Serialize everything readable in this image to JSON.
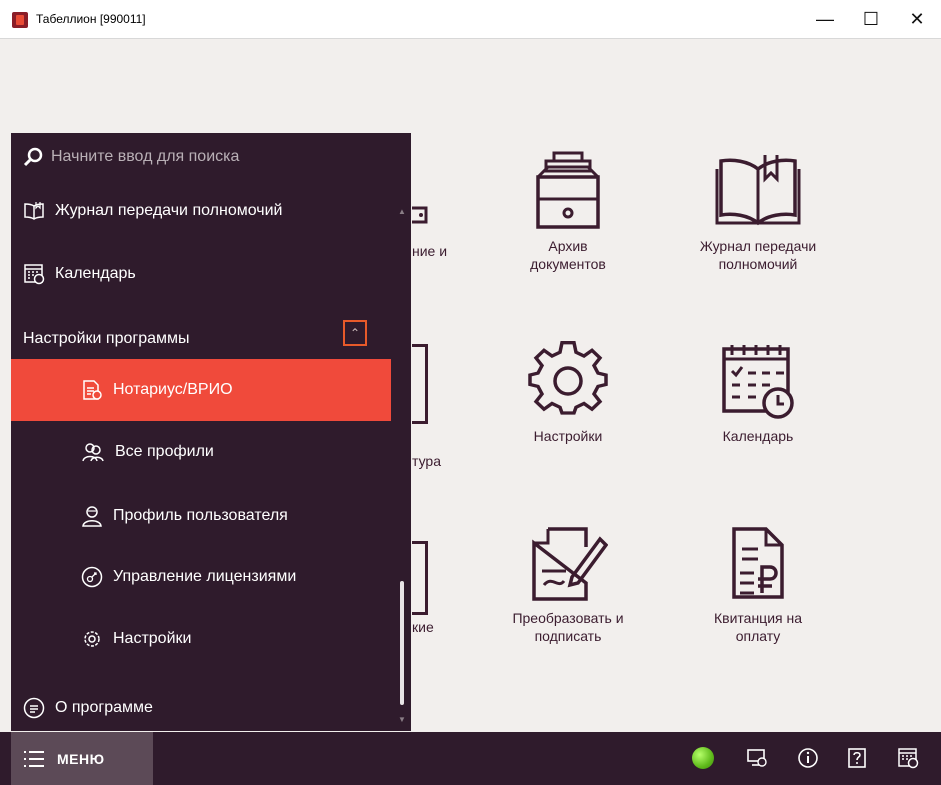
{
  "window": {
    "title": "Табеллион [990011]",
    "minimize": "—",
    "maximize": "☐",
    "close": "✕"
  },
  "tiles": [
    {
      "label": "Архив\nдокументов",
      "icon": "archive-icon"
    },
    {
      "label": "Журнал передачи\nполномочий",
      "icon": "book-icon"
    },
    {
      "label": "Настройки",
      "icon": "gear-icon"
    },
    {
      "label": "Календарь",
      "icon": "calendar-icon"
    },
    {
      "label": "Преобразовать и\nподписать",
      "icon": "sign-document-icon"
    },
    {
      "label": "Квитанция на\nоплату",
      "icon": "receipt-icon"
    }
  ],
  "partial_tiles": {
    "row1_line1": "ние и",
    "row2": "тура",
    "row3": "кие"
  },
  "menu": {
    "search_placeholder": "Начните ввод для поиска",
    "items": [
      {
        "label": "Журнал передачи полномочий",
        "icon": "book-icon"
      },
      {
        "label": "Календарь",
        "icon": "calendar-icon"
      }
    ],
    "section": {
      "label": "Настройки программы",
      "collapse_icon": "double-chevron-up-icon"
    },
    "sub_items": [
      {
        "label": "Нотариус/ВРИО",
        "icon": "notary-doc-icon",
        "active": true
      },
      {
        "label": "Все профили",
        "icon": "profiles-icon"
      },
      {
        "label": "Профиль пользователя",
        "icon": "user-profile-icon"
      },
      {
        "label": "Управление лицензиями",
        "icon": "license-icon"
      },
      {
        "label": "Настройки",
        "icon": "gear-icon"
      }
    ],
    "about": {
      "label": "О программе",
      "icon": "about-icon"
    }
  },
  "bottombar": {
    "menu_label": "МЕНЮ",
    "icons": [
      "status-online-icon",
      "remote-desktop-icon",
      "info-icon",
      "help-icon",
      "calendar-icon"
    ]
  },
  "colors": {
    "accent": "#f04a3b",
    "panel": "#2f1b2c",
    "tile_icon": "#3b1c2f",
    "highlight_border": "#e85a2a"
  }
}
